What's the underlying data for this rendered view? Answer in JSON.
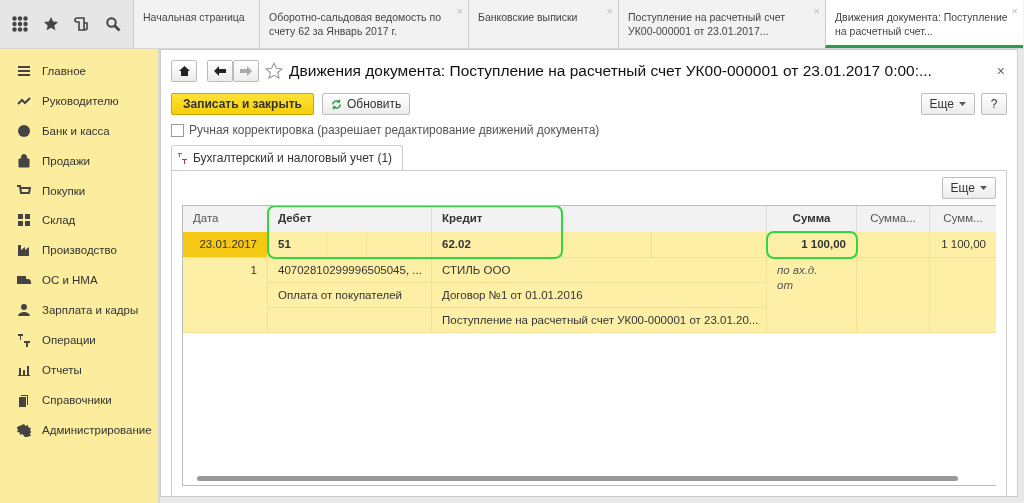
{
  "tabs": [
    {
      "label": "Начальная страница",
      "selected": false
    },
    {
      "label": "Оборотно-сальдовая ведомость по счету 62 за Январь 2017 г.",
      "selected": false,
      "close": "×"
    },
    {
      "label": "Банковские выписки",
      "selected": false,
      "close": "×"
    },
    {
      "label": "Поступление на расчетный счет УК00-000001 от 23.01.2017...",
      "selected": false,
      "close": "×"
    },
    {
      "label": "Движения документа: Поступление на расчетный счет...",
      "selected": true,
      "close": "×"
    }
  ],
  "sidebar": {
    "items": [
      {
        "label": "Главное"
      },
      {
        "label": "Руководителю"
      },
      {
        "label": "Банк и касса"
      },
      {
        "label": "Продажи"
      },
      {
        "label": "Покупки"
      },
      {
        "label": "Склад"
      },
      {
        "label": "Производство"
      },
      {
        "label": "ОС и НМА"
      },
      {
        "label": "Зарплата и кадры"
      },
      {
        "label": "Операции"
      },
      {
        "label": "Отчеты"
      },
      {
        "label": "Справочники"
      },
      {
        "label": "Администрирование"
      }
    ]
  },
  "form": {
    "title": "Движения документа: Поступление на расчетный счет УК00-000001 от 23.01.2017 0:00:...",
    "close": "×",
    "save_button": "Записать и закрыть",
    "refresh_button": "Обновить",
    "more_button": "Еще",
    "help_button": "?",
    "manual_checkbox": {
      "label": "Ручная корректировка (разрешает редактирование движений документа)",
      "checked": false
    },
    "inner_tabs": [
      {
        "label": "Бухгалтерский и налоговый учет (1)",
        "selected": true
      }
    ],
    "table_more_button": "Еще"
  },
  "table": {
    "columns": [
      {
        "label": "Дата",
        "bold": false
      },
      {
        "label": "Дебет",
        "bold": true
      },
      {
        "label": "Кредит",
        "bold": true
      },
      {
        "label": "Сумма",
        "bold": true
      },
      {
        "label": "Сумма...",
        "bold": false
      },
      {
        "label": "Сумм...",
        "bold": false
      }
    ],
    "entry": {
      "date": "23.01.2017",
      "date_selected": true,
      "debit": "51",
      "credit": "62.02",
      "amount": "1 100,00",
      "amount_3": "1 100,00",
      "line_number": "1",
      "debit_details": [
        "40702810299996505045, ...",
        "Оплата от покупателей"
      ],
      "credit_details": [
        "СТИЛЬ ООО",
        "Договор №1 от 01.01.2016",
        "Поступление на расчетный счет УК00-000001 от 23.01.20..."
      ],
      "amount_note": "по вх.д. от"
    },
    "accounts_highlighted": true,
    "amount_highlighted": true
  }
}
